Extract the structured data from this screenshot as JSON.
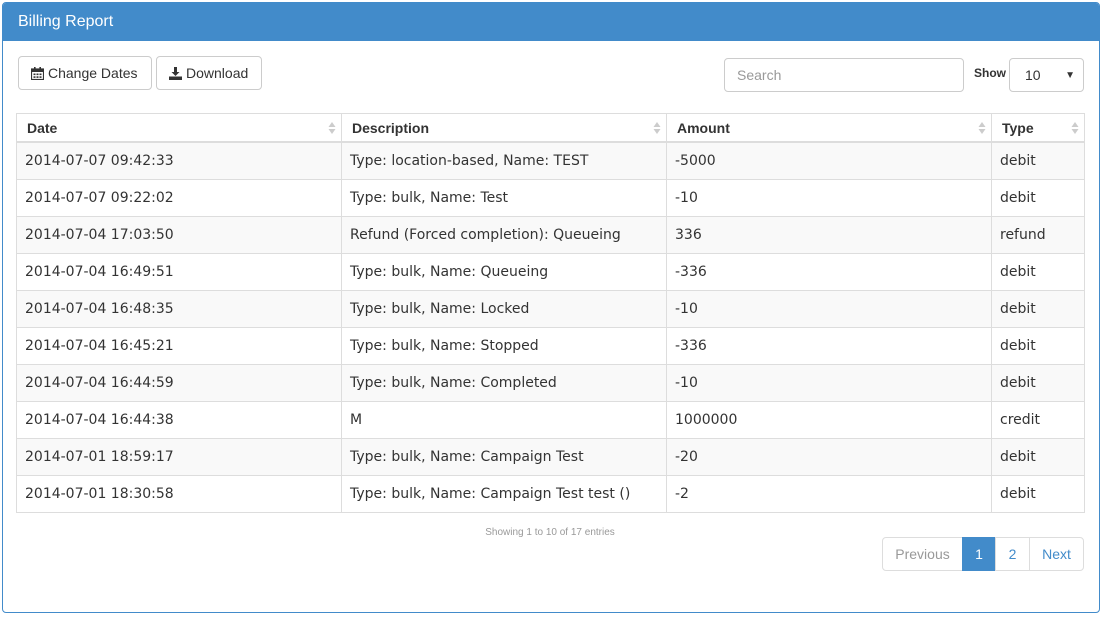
{
  "panel": {
    "title": "Billing Report"
  },
  "toolbar": {
    "change_dates_label": "Change Dates",
    "download_label": "Download",
    "search_placeholder": "Search",
    "show_label": "Show",
    "page_size": "10"
  },
  "table": {
    "headers": [
      "Date",
      "Description",
      "Amount",
      "Type"
    ],
    "rows": [
      [
        "2014-07-07 09:42:33",
        "Type: location-based, Name: TEST",
        "-5000",
        "debit"
      ],
      [
        "2014-07-07 09:22:02",
        "Type: bulk, Name: Test",
        "-10",
        "debit"
      ],
      [
        "2014-07-04 17:03:50",
        "Refund (Forced completion): Queueing",
        "336",
        "refund"
      ],
      [
        "2014-07-04 16:49:51",
        "Type: bulk, Name: Queueing",
        "-336",
        "debit"
      ],
      [
        "2014-07-04 16:48:35",
        "Type: bulk, Name: Locked",
        "-10",
        "debit"
      ],
      [
        "2014-07-04 16:45:21",
        "Type: bulk, Name: Stopped",
        "-336",
        "debit"
      ],
      [
        "2014-07-04 16:44:59",
        "Type: bulk, Name: Completed",
        "-10",
        "debit"
      ],
      [
        "2014-07-04 16:44:38",
        "M",
        "1000000",
        "credit"
      ],
      [
        "2014-07-01 18:59:17",
        "Type: bulk, Name: Campaign Test",
        "-20",
        "debit"
      ],
      [
        "2014-07-01 18:30:58",
        "Type: bulk, Name: Campaign Test test ()",
        "-2",
        "debit"
      ]
    ]
  },
  "footer": {
    "info": "Showing 1 to 10 of 17 entries",
    "pagination": {
      "previous": "Previous",
      "pages": [
        "1",
        "2"
      ],
      "next": "Next",
      "active_page": "1"
    }
  },
  "icons": {
    "change_dates": "calendar-icon",
    "download": "download-icon",
    "select": "caret-down-icon",
    "sort": "sort-icon"
  },
  "colors": {
    "primary": "#428bca",
    "border": "#dddddd",
    "stripe": "#f9f9f9",
    "muted": "#999999"
  }
}
